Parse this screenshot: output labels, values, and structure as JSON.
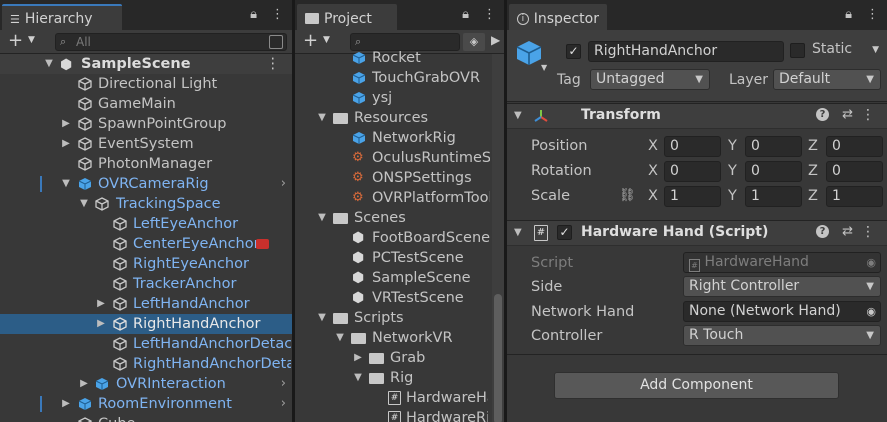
{
  "hierarchy": {
    "tab_label": "Hierarchy",
    "search_placeholder": "All",
    "scene_name": "SampleScene",
    "items": [
      {
        "label": "Directional Light"
      },
      {
        "label": "GameMain"
      },
      {
        "label": "SpawnPointGroup"
      },
      {
        "label": "EventSystem"
      },
      {
        "label": "PhotonManager"
      },
      {
        "label": "OVRCameraRig"
      },
      {
        "label": "TrackingSpace"
      },
      {
        "label": "LeftEyeAnchor"
      },
      {
        "label": "CenterEyeAnchor"
      },
      {
        "label": "RightEyeAnchor"
      },
      {
        "label": "TrackerAnchor"
      },
      {
        "label": "LeftHandAnchor"
      },
      {
        "label": "RightHandAnchor"
      },
      {
        "label": "LeftHandAnchorDetached"
      },
      {
        "label": "RightHandAnchorDetached"
      },
      {
        "label": "OVRInteraction"
      },
      {
        "label": "RoomEnvironment"
      },
      {
        "label": "Cube"
      }
    ]
  },
  "project": {
    "tab_label": "Project",
    "items": [
      {
        "label": "Rocket"
      },
      {
        "label": "TouchGrabOVR"
      },
      {
        "label": "ysj"
      },
      {
        "label": "Resources"
      },
      {
        "label": "NetworkRig"
      },
      {
        "label": "OculusRuntimeSettings"
      },
      {
        "label": "ONSPSettings"
      },
      {
        "label": "OVRPlatformToolSettings"
      },
      {
        "label": "Scenes"
      },
      {
        "label": "FootBoardScene"
      },
      {
        "label": "PCTestScene"
      },
      {
        "label": "SampleScene"
      },
      {
        "label": "VRTestScene"
      },
      {
        "label": "Scripts"
      },
      {
        "label": "NetworkVR"
      },
      {
        "label": "Grab"
      },
      {
        "label": "Rig"
      },
      {
        "label": "HardwareHand"
      },
      {
        "label": "HardwareRig"
      }
    ]
  },
  "inspector": {
    "tab_label": "Inspector",
    "object_name": "RightHandAnchor",
    "static_label": "Static",
    "tag_label": "Tag",
    "tag_value": "Untagged",
    "layer_label": "Layer",
    "layer_value": "Default",
    "transform": {
      "title": "Transform",
      "position_label": "Position",
      "rotation_label": "Rotation",
      "scale_label": "Scale",
      "axis_x": "X",
      "axis_y": "Y",
      "axis_z": "Z",
      "position": {
        "x": "0",
        "y": "0",
        "z": "0"
      },
      "rotation": {
        "x": "0",
        "y": "0",
        "z": "0"
      },
      "scale": {
        "x": "1",
        "y": "1",
        "z": "1"
      }
    },
    "script_component": {
      "title": "Hardware Hand (Script)",
      "script_label": "Script",
      "script_value": "HardwareHand",
      "side_label": "Side",
      "side_value": "Right Controller",
      "network_hand_label": "Network Hand",
      "network_hand_value": "None (Network Hand)",
      "controller_label": "Controller",
      "controller_value": "R Touch"
    },
    "add_component_label": "Add Component"
  },
  "colors": {
    "accent": "#3a79bb",
    "selection": "#2c5d87",
    "prefab_blue": "#7fb4f2"
  }
}
